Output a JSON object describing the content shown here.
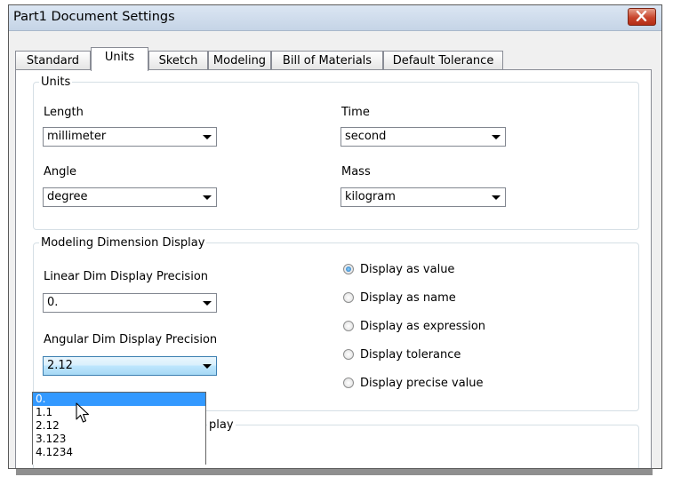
{
  "window": {
    "title": "Part1 Document Settings"
  },
  "tabs": [
    "Standard",
    "Units",
    "Sketch",
    "Modeling",
    "Bill of Materials",
    "Default Tolerance"
  ],
  "active_tab": "Units",
  "units": {
    "legend": "Units",
    "length_label": "Length",
    "length_value": "millimeter",
    "time_label": "Time",
    "time_value": "second",
    "angle_label": "Angle",
    "angle_value": "degree",
    "mass_label": "Mass",
    "mass_value": "kilogram"
  },
  "modeling": {
    "legend": "Modeling Dimension Display",
    "linear_label": "Linear Dim Display Precision",
    "linear_value": "0.",
    "angular_label": "Angular Dim Display Precision",
    "angular_value": "2.12",
    "radios": [
      {
        "label": "Display as value",
        "checked": true
      },
      {
        "label": "Display as name",
        "checked": false
      },
      {
        "label": "Display as expression",
        "checked": false
      },
      {
        "label": "Display tolerance",
        "checked": false
      },
      {
        "label": "Display precise value",
        "checked": false
      }
    ]
  },
  "partial_group": {
    "legend_fragment": "play"
  },
  "angular_dropdown": {
    "options": [
      "0.",
      "1.1",
      "2.12",
      "3.123",
      "4.1234"
    ],
    "highlighted": "0."
  },
  "icons": {
    "close": "close-icon",
    "dropdown": "chevron-down-icon",
    "cursor": "mouse-pointer-icon"
  },
  "colors": {
    "titlebar": "#c5d4e6",
    "close": "#c8442c",
    "highlight": "#3399ff",
    "panel": "#f0f0f0"
  }
}
